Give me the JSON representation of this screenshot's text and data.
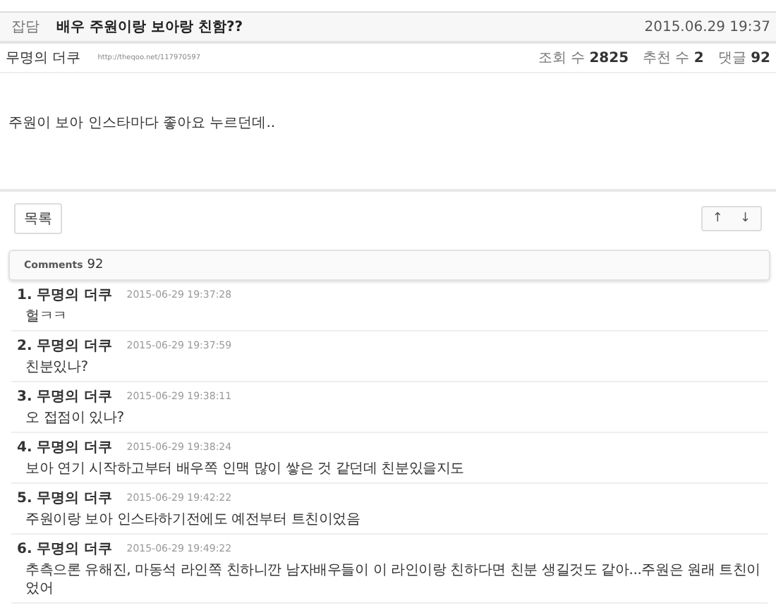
{
  "post": {
    "category": "잡담",
    "title": "배우 주원이랑 보아랑 친함??",
    "date": "2015.06.29 19:37",
    "author": "무명의 더쿠",
    "url": "http://theqoo.net/117970597",
    "stats": [
      {
        "label": "조회 수",
        "value": "2825"
      },
      {
        "label": "추천 수",
        "value": "2"
      },
      {
        "label": "댓글",
        "value": "92"
      }
    ],
    "body": "주원이 보아 인스타마다 좋아요 누르던데.."
  },
  "buttons": {
    "list": "목록",
    "up": "↑",
    "down": "↓"
  },
  "comments_header": {
    "label": "Comments",
    "count": "92"
  },
  "comments": [
    {
      "number": "1.",
      "author": "무명의 더쿠",
      "time": "2015-06-29 19:37:28",
      "text": "헐ㅋㅋ"
    },
    {
      "number": "2.",
      "author": "무명의 더쿠",
      "time": "2015-06-29 19:37:59",
      "text": "친분있나?"
    },
    {
      "number": "3.",
      "author": "무명의 더쿠",
      "time": "2015-06-29 19:38:11",
      "text": "오 접점이 있나?"
    },
    {
      "number": "4.",
      "author": "무명의 더쿠",
      "time": "2015-06-29 19:38:24",
      "text": "보아 연기 시작하고부터 배우쪽 인맥 많이 쌓은 것 같던데 친분있을지도"
    },
    {
      "number": "5.",
      "author": "무명의 더쿠",
      "time": "2015-06-29 19:42:22",
      "text": "주원이랑 보아 인스타하기전에도 예전부터 트친이었음"
    },
    {
      "number": "6.",
      "author": "무명의 더쿠",
      "time": "2015-06-29 19:49:22",
      "text": "추측으론 유해진, 마동석 라인쪽 친하니깐 남자배우들이 이 라인이랑 친하다면 친분 생길것도 같아...주원은 원래 트친이었어"
    }
  ]
}
